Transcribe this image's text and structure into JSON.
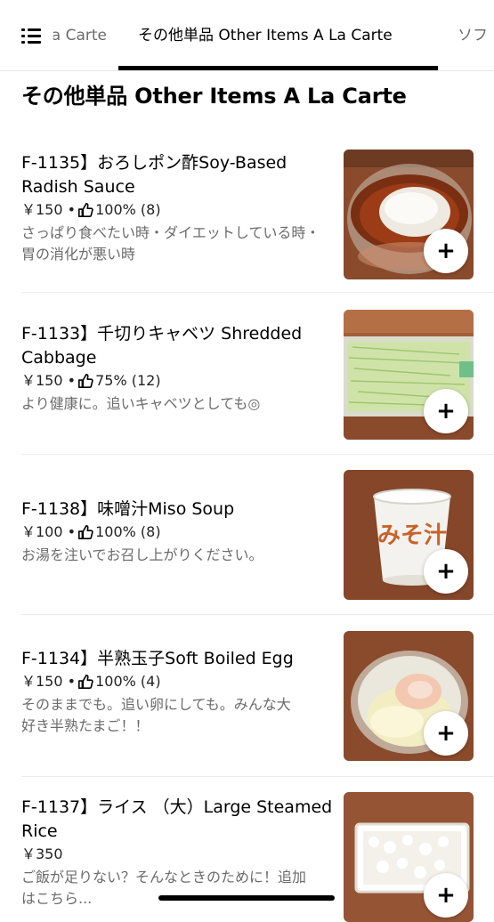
{
  "tabs": {
    "prev_label": "a La Carte",
    "active_label": "その他単品 Other Items A La Carte",
    "next_label": "ソフ"
  },
  "section_title": "その他単品 Other Items A La Carte",
  "items": [
    {
      "name": "F-1135】おろしポン酢Soy-Based Radish Sauce",
      "price": "￥150",
      "rating": "100% (8)",
      "description": "さっぱり食べたい時・ダイエットしている時・胃の消化が悪い時",
      "image_icon": "radish-sauce-image",
      "add_label": "+"
    },
    {
      "name": "F-1133】千切りキャベツ Shredded Cabbage",
      "price": "￥150",
      "rating": "75% (12)",
      "description": "より健康に。追いキャベツとしても◎",
      "image_icon": "shredded-cabbage-image",
      "add_label": "+"
    },
    {
      "name": "F-1138】味噌汁Miso Soup",
      "price": "￥100",
      "rating": "100% (8)",
      "description": "お湯を注いでお召し上がりください。",
      "image_icon": "miso-soup-image",
      "image_text": "みそ汁",
      "add_label": "+"
    },
    {
      "name": "F-1134】半熟玉子Soft Boiled Egg",
      "price": "￥150",
      "rating": "100% (4)",
      "description": "そのままでも。追い卵にしても。みんな大好き半熟たまご！！",
      "image_icon": "soft-boiled-egg-image",
      "add_label": "+"
    },
    {
      "name": "F-1137】ライス （大）Large Steamed Rice",
      "price": "￥350",
      "rating": "",
      "description": "ご飯が足りない？そんなときのために！追加はこちら...",
      "image_icon": "steamed-rice-image",
      "add_label": "+"
    }
  ],
  "colors": {
    "text_primary": "#000000",
    "text_secondary": "#6b6b6b",
    "tab_inactive": "#6b6b6b",
    "divider": "#ececec",
    "wood_background": "#8a4a2c"
  }
}
